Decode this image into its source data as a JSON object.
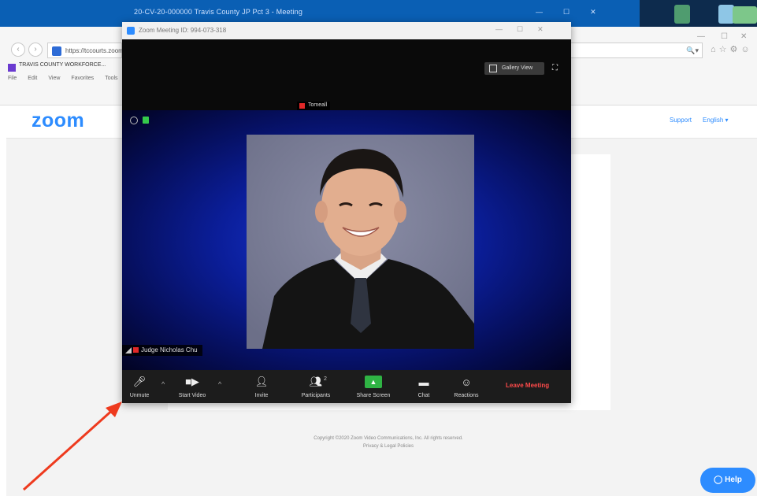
{
  "os": {
    "window_title": "20-CV-20-000000 Travis County JP Pct 3 - Meeting",
    "controls": [
      "—",
      "☐",
      "✕"
    ]
  },
  "browser": {
    "url": "https://tccourts.zoom.us",
    "address_tools": "🔍▾",
    "toolbar_icons": "⌂☆⚙☺",
    "favorite_label": "TRAVIS COUNTY WORKFORCE...",
    "menu": [
      "File",
      "Edit",
      "View",
      "Favorites",
      "Tools"
    ],
    "win_min": "—",
    "win_max": "☐",
    "win_close": "✕"
  },
  "webpage": {
    "logo": "zoom",
    "links": {
      "support": "Support",
      "language": "English ▾"
    },
    "footer_line1": "Copyright ©2020 Zoom Video Communications, Inc. All rights reserved.",
    "footer_line2": "Privacy & Legal Policies",
    "help": "Help"
  },
  "zoom_window": {
    "title": "Zoom Meeting ID: 994-073-318",
    "controls": [
      "—",
      "☐",
      "✕"
    ],
    "gallery_view": "Gallery View",
    "self_tile_name": "Tomeall",
    "speaker_name": "Judge Nicholas Chu",
    "toolbar": {
      "unmute": "Unmute",
      "start_video": "Start Video",
      "invite": "Invite",
      "participants": "Participants",
      "participant_count": "2",
      "share_screen": "Share Screen",
      "chat": "Chat",
      "reactions": "Reactions",
      "leave": "Leave Meeting"
    }
  },
  "colors": {
    "zoom_blue": "#2d8cff",
    "leave_red": "#ff4a4a",
    "share_green": "#2fb344",
    "arrow_red": "#ee3a1e"
  }
}
